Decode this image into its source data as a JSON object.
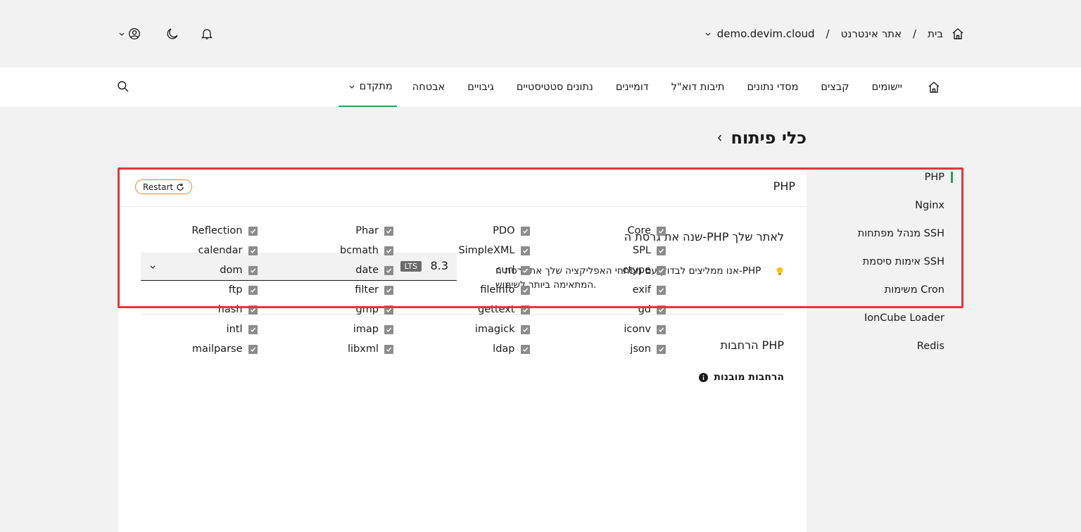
{
  "header": {
    "breadcrumb": [
      "בית",
      "אתר אינטרנט",
      "demo.devim.cloud"
    ],
    "separator": "/"
  },
  "nav": {
    "items": [
      "יישומים",
      "קבצים",
      "מסדי נתונים",
      "תיבות דוא\"ל",
      "דומיינים",
      "נתונים סטטיסטיים",
      "גיבויים",
      "אבטחה",
      "מתקדם"
    ]
  },
  "page": {
    "title": "כלי פיתוח"
  },
  "card": {
    "title": "PHP",
    "restart_label": "Restart",
    "version_title": "שנה את גרסת ה-PHP לאתר שלך",
    "hint_text": "אנו ממליצים לבדוק עם מפתחי האפליקציה שלך את גרסת ה-PHP המתאימה ביותר לשימוש.",
    "version_value": "8.3",
    "version_badge": "LTS",
    "extensions_title": "הרחבות PHP",
    "builtin_title": "הרחבות מובנות",
    "extensions": [
      "Core",
      "PDO",
      "Phar",
      "Reflection",
      "SPL",
      "SimpleXML",
      "bcmath",
      "calendar",
      "ctype",
      "curl",
      "date",
      "dom",
      "exif",
      "fileinfo",
      "filter",
      "ftp",
      "gd",
      "gettext",
      "gmp",
      "hash",
      "iconv",
      "imagick",
      "imap",
      "intl",
      "json",
      "ldap",
      "libxml",
      "mailparse"
    ]
  },
  "side_menu": {
    "items": [
      "PHP",
      "Nginx",
      "מנהל מפתחות SSH",
      "אימות סיסמת SSH",
      "משימות Cron",
      "IonCube Loader",
      "Redis"
    ]
  },
  "colors": {
    "accent": "#3a9a5b",
    "highlight": "#e8343a",
    "restart_border": "#e0892f"
  }
}
